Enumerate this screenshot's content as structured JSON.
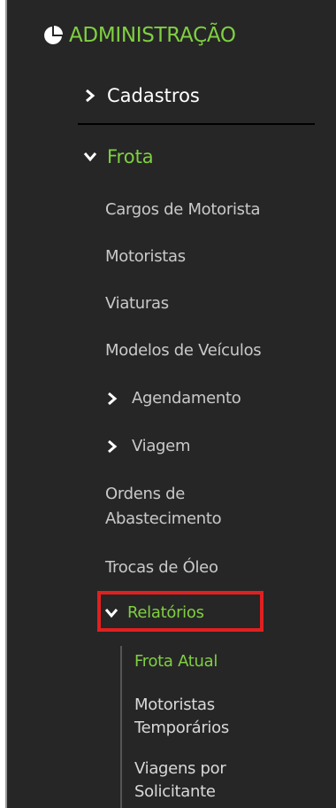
{
  "menu": {
    "section_title": "ADMINISTRAÇÃO",
    "section_icon": "pie-chart-icon",
    "colors": {
      "background": "#262626",
      "accent_green": "#7fd041",
      "highlight_red": "#e02020"
    },
    "cadastros": {
      "label": "Cadastros",
      "icon": "chevron-right-icon",
      "expanded": false
    },
    "frota": {
      "label": "Frota",
      "icon": "chevron-down-icon",
      "expanded": true,
      "items": [
        "Cargos de Motorista",
        "Motoristas",
        "Viaturas",
        "Modelos de Veículos"
      ],
      "agendamento": {
        "label": "Agendamento",
        "icon": "chevron-right-icon",
        "expanded": false
      },
      "viagem": {
        "label": "Viagem",
        "icon": "chevron-right-icon",
        "expanded": false
      },
      "ordens_line1": "Ordens de",
      "ordens_line2": "Abastecimento",
      "trocas": "Trocas de Óleo",
      "relatorios": {
        "label": "Relatórios",
        "icon": "chevron-down-icon",
        "expanded": true,
        "highlighted": true,
        "items": {
          "frota_atual": "Frota Atual",
          "motoristas_line1": "Motoristas",
          "motoristas_line2": "Temporários",
          "viagens_line1": "Viagens por",
          "viagens_line2": "Solicitante"
        }
      }
    }
  }
}
